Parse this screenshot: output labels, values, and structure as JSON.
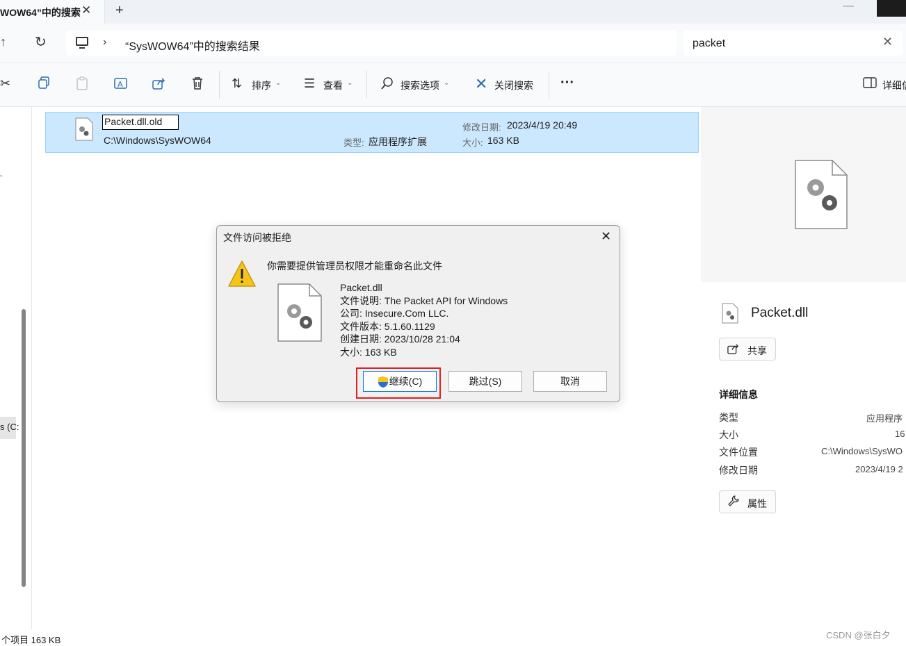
{
  "tab": {
    "title": "WOW64”中的搜索",
    "close_icon": "close-icon",
    "new_tab_glyph": "+"
  },
  "nav": {
    "up_icon": "up-arrow-icon",
    "refresh_icon": "refresh-icon"
  },
  "address": {
    "path_text": "“SysWOW64”中的搜索结果",
    "icon": "computer-icon"
  },
  "search": {
    "value": "packet"
  },
  "toolbar": {
    "sort_label": "排序",
    "view_label": "查看",
    "search_options_label": "搜索选项",
    "close_search_label": "关闭搜索",
    "more_glyph": "···",
    "details_label": "详细信"
  },
  "leftnav": {
    "drive_label": "s (C:"
  },
  "file": {
    "rename_value": "Packet.dll.old",
    "path": "C:\\Windows\\SysWOW64",
    "type_label": "类型:",
    "type_value": "应用程序扩展",
    "date_label": "修改日期:",
    "date_value": "2023/4/19 20:49",
    "size_label": "大小:",
    "size_value": "163 KB"
  },
  "dialog": {
    "title": "文件访问被拒绝",
    "message": "你需要提供管理员权限才能重命名此文件",
    "info": [
      "Packet.dll",
      "文件说明: The Packet API for Windows",
      "公司: Insecure.Com LLC.",
      "文件版本: 5.1.60.1129",
      "创建日期: 2023/10/28 21:04",
      "大小: 163 KB"
    ],
    "continue_label": "继续(C)",
    "skip_label": "跳过(S)",
    "cancel_label": "取消"
  },
  "details": {
    "filename": "Packet.dll",
    "share_label": "共享",
    "section_title": "详细信息",
    "rows": [
      {
        "label": "类型",
        "value": "应用程序"
      },
      {
        "label": "大小",
        "value": "16"
      },
      {
        "label": "文件位置",
        "value": "C:\\Windows\\SysWO"
      },
      {
        "label": "修改日期",
        "value": "2023/4/19 2"
      }
    ],
    "properties_label": "属性"
  },
  "status": {
    "text": "个项目  163 KB"
  },
  "watermark": "CSDN @张白夕",
  "colors": {
    "selection": "#cce8ff",
    "selection_border": "#99d1ff",
    "highlight": "#e02020",
    "accent": "#0078d7"
  }
}
